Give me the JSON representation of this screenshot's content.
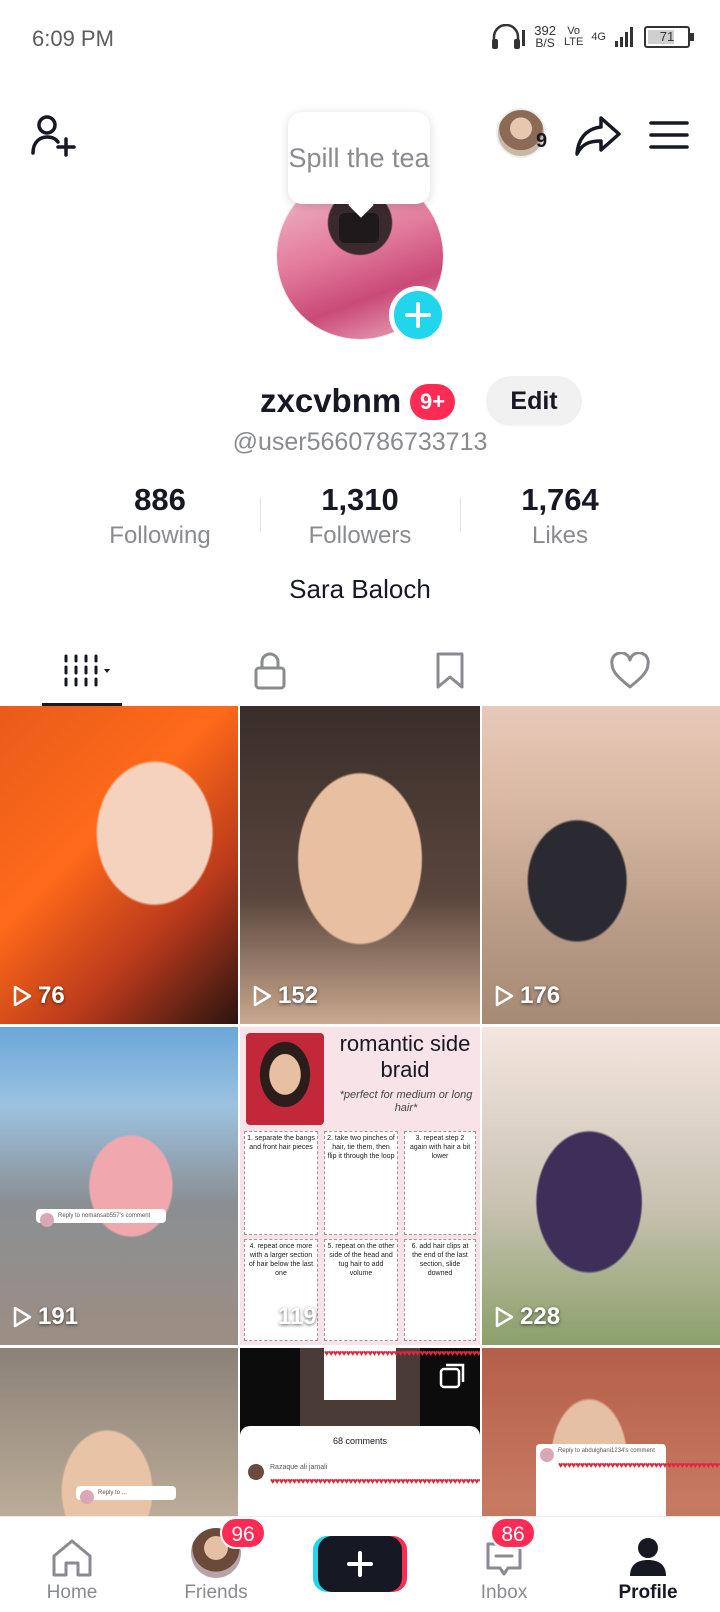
{
  "status_bar": {
    "time": "6:09 PM",
    "speed_value": "392",
    "speed_unit": "B/S",
    "volte_line1": "Vo",
    "volte_line2": "LTE",
    "network": "4G",
    "battery": "71",
    "battery_level": 0.71
  },
  "tooltip": {
    "text": "Spill the tea"
  },
  "profile": {
    "visitor_count": "9",
    "username": "zxcvbnm",
    "notification_badge": "9+",
    "edit_label": "Edit",
    "handle": "@user5660786733713",
    "bio": "Sara Baloch"
  },
  "stats": [
    {
      "value": "886",
      "label": "Following"
    },
    {
      "value": "1,310",
      "label": "Followers"
    },
    {
      "value": "1,764",
      "label": "Likes"
    }
  ],
  "tabs": [
    {
      "icon": "videos-grid-icon",
      "active": true
    },
    {
      "icon": "lock-icon",
      "active": false
    },
    {
      "icon": "bookmark-icon",
      "active": false
    },
    {
      "icon": "heart-icon",
      "active": false
    }
  ],
  "videos": [
    {
      "views": "76"
    },
    {
      "views": "152"
    },
    {
      "views": "176"
    },
    {
      "views": "191",
      "comment_text": "Reply to nomansab557's comment"
    },
    {
      "views": "119",
      "title": "romantic side braid",
      "subtitle": "*perfect for medium or long hair*",
      "steps": [
        "1. separate the bangs and front hair pieces",
        "2. take two pinches of hair, tie them, then flip it through the loop",
        "3. repeat step 2 again with hair a bit lower",
        "4. repeat once more with a larger section of hair below the last one",
        "5. repeat on the other side of the head and tug hair to add volume",
        "6. add hair clips at the end of the last section, slide downed"
      ]
    },
    {
      "views": "228"
    },
    {
      "views": "",
      "comment_text": "Reply to ..."
    },
    {
      "views": "",
      "sheet_title": "68 comments",
      "sheet_name": "Razaque ali jamali"
    },
    {
      "views": "",
      "comment_text": "Reply to abdulghani1234's comment"
    }
  ],
  "bottom_nav": [
    {
      "label": "Home",
      "icon": "home-icon",
      "badge": ""
    },
    {
      "label": "Friends",
      "icon": "friends-avatar",
      "badge": "96"
    },
    {
      "label": "",
      "icon": "plus-icon",
      "badge": ""
    },
    {
      "label": "Inbox",
      "icon": "inbox-icon",
      "badge": "86"
    },
    {
      "label": "Profile",
      "icon": "profile-icon",
      "badge": ""
    }
  ],
  "colors": {
    "accent_red": "#fe2c55",
    "accent_cyan": "#20d5ec",
    "text_primary": "#161823",
    "text_secondary": "#8a8b91"
  }
}
